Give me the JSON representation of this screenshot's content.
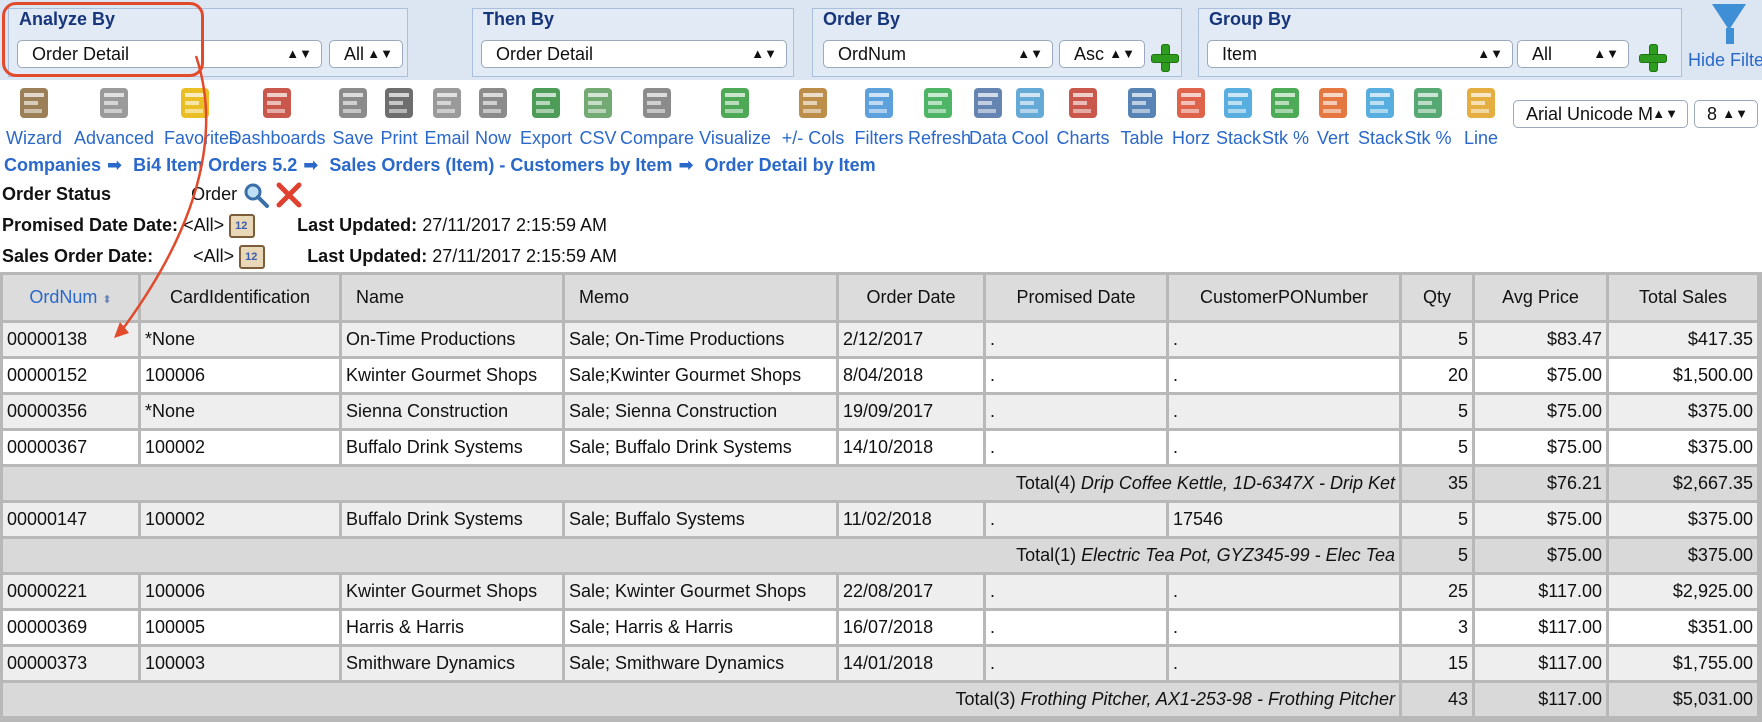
{
  "filters": {
    "analyze_by": {
      "title": "Analyze By",
      "field": "Order Detail",
      "scope": "All"
    },
    "then_by": {
      "title": "Then By",
      "field": "Order Detail"
    },
    "order_by": {
      "title": "Order By",
      "field": "OrdNum",
      "direction": "Asc"
    },
    "group_by": {
      "title": "Group By",
      "field": "Item",
      "scope": "All"
    },
    "hide_filters_label": "Hide Filters"
  },
  "toolbar": {
    "items": [
      {
        "label": "Wizard",
        "icon": "wizard-icon"
      },
      {
        "label": "Advanced",
        "icon": "gear-icon"
      },
      {
        "label": "Favorites",
        "icon": "star-icon"
      },
      {
        "label": "Dashboards",
        "icon": "dashboard-icon"
      },
      {
        "label": "Save",
        "icon": "save-icon"
      },
      {
        "label": "Print",
        "icon": "print-icon"
      },
      {
        "label": "Email",
        "icon": "email-icon"
      },
      {
        "label": "Now",
        "icon": "now-icon"
      },
      {
        "label": "Export",
        "icon": "excel-icon"
      },
      {
        "label": "CSV",
        "icon": "csv-icon"
      },
      {
        "label": "Compare",
        "icon": "compare-icon"
      },
      {
        "label": "Visualize",
        "icon": "visualize-icon"
      },
      {
        "label": "+/- Cols",
        "icon": "columns-icon"
      },
      {
        "label": "Filters",
        "icon": "filter-icon"
      },
      {
        "label": "Refresh",
        "icon": "refresh-icon"
      },
      {
        "label": "Data",
        "icon": "data-icon"
      },
      {
        "label": "Cool",
        "icon": "cool-icon"
      },
      {
        "label": "Charts",
        "icon": "charts-icon"
      },
      {
        "label": "Table",
        "icon": "table-icon"
      },
      {
        "label": "Horz",
        "icon": "horz-bar-icon"
      },
      {
        "label": "Stack",
        "icon": "stack-horz-icon"
      },
      {
        "label": "Stk %",
        "icon": "stack-pct-horz-icon"
      },
      {
        "label": "Vert",
        "icon": "vert-bar-icon"
      },
      {
        "label": "Stack",
        "icon": "stack-vert-icon"
      },
      {
        "label": "Stk %",
        "icon": "stack-pct-vert-icon"
      },
      {
        "label": "Line",
        "icon": "line-chart-icon"
      }
    ],
    "font_family": "Arial Unicode M",
    "font_size": "8"
  },
  "breadcrumb": [
    "Companies",
    "Bi4 Item Orders 5.2",
    "Sales Orders (Item) - Customers by Item",
    "Order Detail by Item"
  ],
  "params": {
    "order_status_label": "Order Status",
    "order_status_value": "Order",
    "promised_label": "Promised Date Date:",
    "promised_value": "<All>",
    "sales_label": "Sales Order Date:",
    "sales_value": "<All>",
    "last_updated_label": "Last Updated:",
    "promised_last_updated": "27/11/2017 2:15:59 AM",
    "sales_last_updated": "27/11/2017 2:15:59 AM"
  },
  "table": {
    "columns": [
      "OrdNum",
      "CardIdentification",
      "Name",
      "Memo",
      "Order Date",
      "Promised Date",
      "CustomerPONumber",
      "Qty",
      "Avg Price",
      "Total Sales"
    ],
    "rows": [
      {
        "type": "data",
        "cells": [
          "00000138",
          "*None",
          "On-Time Productions",
          "Sale; On-Time Productions",
          "2/12/2017",
          ".",
          ".",
          "5",
          "$83.47",
          "$417.35"
        ]
      },
      {
        "type": "data",
        "cells": [
          "00000152",
          "100006",
          "Kwinter Gourmet Shops",
          "Sale;Kwinter Gourmet Shops",
          "8/04/2018",
          ".",
          ".",
          "20",
          "$75.00",
          "$1,500.00"
        ]
      },
      {
        "type": "data",
        "cells": [
          "00000356",
          "*None",
          "Sienna Construction",
          "Sale; Sienna Construction",
          "19/09/2017",
          ".",
          ".",
          "5",
          "$75.00",
          "$375.00"
        ]
      },
      {
        "type": "data",
        "cells": [
          "00000367",
          "100002",
          "Buffalo Drink Systems",
          "Sale; Buffalo Drink Systems",
          "14/10/2018",
          ".",
          ".",
          "5",
          "$75.00",
          "$375.00"
        ]
      },
      {
        "type": "total",
        "prefix": "Total(4)",
        "item": "Drip Coffee Kettle, 1D-6347X - Drip Ket",
        "qty": "35",
        "avg": "$76.21",
        "total": "$2,667.35"
      },
      {
        "type": "data",
        "cells": [
          "00000147",
          "100002",
          "Buffalo Drink Systems",
          "Sale; Buffalo Systems",
          "11/02/2018",
          ".",
          "17546",
          "5",
          "$75.00",
          "$375.00"
        ]
      },
      {
        "type": "total",
        "prefix": "Total(1)",
        "item": "Electric Tea Pot, GYZ345-99 - Elec Tea",
        "qty": "5",
        "avg": "$75.00",
        "total": "$375.00"
      },
      {
        "type": "data",
        "cells": [
          "00000221",
          "100006",
          "Kwinter Gourmet Shops",
          "Sale; Kwinter Gourmet Shops",
          "22/08/2017",
          ".",
          ".",
          "25",
          "$117.00",
          "$2,925.00"
        ]
      },
      {
        "type": "data",
        "cells": [
          "00000369",
          "100005",
          "Harris & Harris",
          "Sale; Harris & Harris",
          "16/07/2018",
          ".",
          ".",
          "3",
          "$117.00",
          "$351.00"
        ]
      },
      {
        "type": "data",
        "cells": [
          "00000373",
          "100003",
          "Smithware Dynamics",
          "Sale; Smithware Dynamics",
          "14/01/2018",
          ".",
          ".",
          "15",
          "$117.00",
          "$1,755.00"
        ]
      },
      {
        "type": "total",
        "prefix": "Total(3)",
        "item": "Frothing Pitcher, AX1-253-98 - Frothing Pitcher",
        "qty": "43",
        "avg": "$117.00",
        "total": "$5,031.00"
      }
    ]
  },
  "colors": {
    "link_blue": "#2a68c9",
    "title_navy": "#17357a",
    "annotation_red": "#e24a2c",
    "add_green": "#2e9c1e"
  }
}
